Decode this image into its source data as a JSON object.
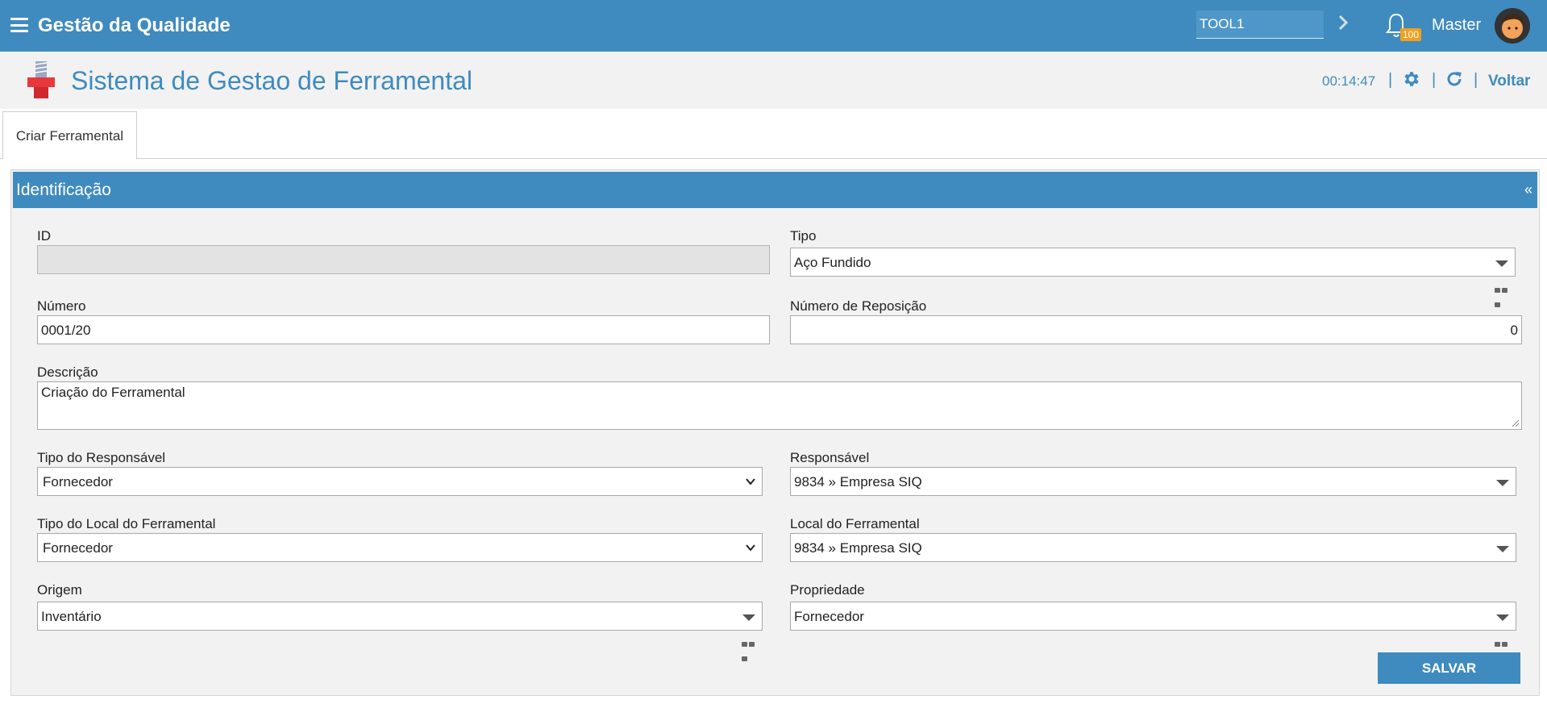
{
  "topbar": {
    "app_title": "Gestão da Qualidade",
    "search_value": "TOOL1",
    "notification_count": "100",
    "username": "Master"
  },
  "header": {
    "page_title": "Sistema de Gestao de Ferramental",
    "clock": "00:14:47",
    "separator": "|",
    "voltar_label": "Voltar"
  },
  "tabs": [
    {
      "label": "Criar Ferramental"
    }
  ],
  "panel": {
    "title": "Identificação",
    "collapse_glyph": "«"
  },
  "form": {
    "id": {
      "label": "ID",
      "value": ""
    },
    "tipo": {
      "label": "Tipo",
      "value": "Aço Fundido"
    },
    "numero": {
      "label": "Número",
      "value": "0001/20"
    },
    "numero_reposicao": {
      "label": "Número de Reposição",
      "value": "0"
    },
    "descricao": {
      "label": "Descrição",
      "value": "Criação do Ferramental"
    },
    "tipo_responsavel": {
      "label": "Tipo do Responsável",
      "value": "Fornecedor"
    },
    "responsavel": {
      "label": "Responsável",
      "value": "9834 » Empresa SIQ"
    },
    "tipo_local": {
      "label": "Tipo do Local do Ferramental",
      "value": "Fornecedor"
    },
    "local": {
      "label": "Local do Ferramental",
      "value": "9834 » Empresa SIQ"
    },
    "origem": {
      "label": "Origem",
      "value": "Inventário"
    },
    "propriedade": {
      "label": "Propriedade",
      "value": "Fornecedor"
    }
  },
  "actions": {
    "save_label": "SALVAR"
  },
  "colors": {
    "primary": "#3f8bbf",
    "badge": "#f0a020",
    "panel_bg": "#f2f2f2"
  },
  "icons": [
    "menu-icon",
    "chevron-right-icon",
    "bell-icon",
    "avatar",
    "tool-logo-icon",
    "gear-icon",
    "refresh-icon",
    "caret-down-icon",
    "chevron-down-icon",
    "more-icon"
  ]
}
